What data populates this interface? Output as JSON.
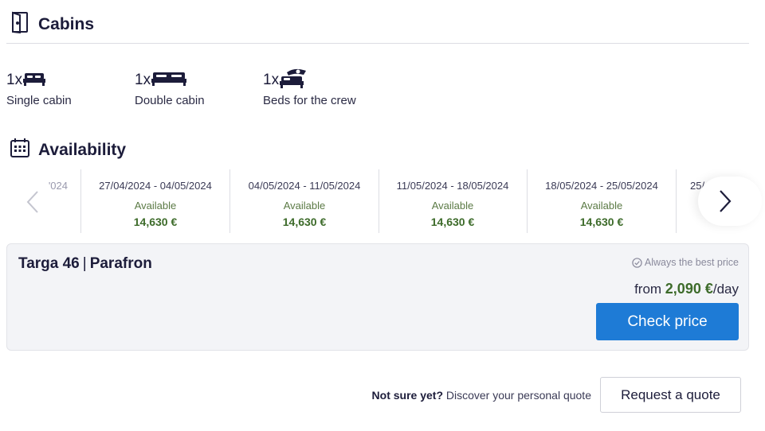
{
  "cabins": {
    "title": "Cabins",
    "items": [
      {
        "count": "1x",
        "label": "Single cabin",
        "icon": "single-bed-icon"
      },
      {
        "count": "1x",
        "label": "Double cabin",
        "icon": "double-bed-icon"
      },
      {
        "count": "1x",
        "label": "Beds for the crew",
        "icon": "crew-bed-icon"
      }
    ]
  },
  "availability": {
    "title": "Availability",
    "weeks": [
      {
        "dates": "'024",
        "status": "",
        "price": ""
      },
      {
        "dates": "27/04/2024 - 04/05/2024",
        "status": "Available",
        "price": "14,630 €"
      },
      {
        "dates": "04/05/2024 - 11/05/2024",
        "status": "Available",
        "price": "14,630 €"
      },
      {
        "dates": "11/05/2024 - 18/05/2024",
        "status": "Available",
        "price": "14,630 €"
      },
      {
        "dates": "18/05/2024 - 25/05/2024",
        "status": "Available",
        "price": "14,630 €"
      },
      {
        "dates": "25/",
        "status": "",
        "price": ""
      }
    ]
  },
  "offer": {
    "model": "Targa 46",
    "separator": "|",
    "name": "Parafron",
    "best_price_note": "Always the best price",
    "price_prefix": "from",
    "price_amount": "2,090 €",
    "price_suffix": "/day",
    "check_price_label": "Check price"
  },
  "quote": {
    "bold_text": "Not sure yet?",
    "text": "Discover your personal quote",
    "button_label": "Request a quote"
  },
  "colors": {
    "text": "#1c1c3a",
    "accent_blue": "#1e7bd6",
    "price_green": "#3d6b2a",
    "card_bg": "#f3f4f7"
  }
}
